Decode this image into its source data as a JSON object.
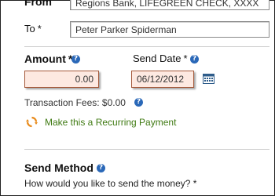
{
  "from": {
    "label": "From",
    "value": "Regions Bank, LIFEGREEN CHECK, XXXX"
  },
  "to": {
    "label": "To",
    "required_mark": "*",
    "value": "Peter Parker Spiderman"
  },
  "amount": {
    "label": "Amount",
    "required_mark": "*",
    "value": "0.00"
  },
  "send_date": {
    "label": "Send Date",
    "required_mark": "*",
    "value": "06/12/2012"
  },
  "fees": {
    "text": "Transaction Fees: $0.00"
  },
  "recurring": {
    "label": "Make this a Recurring Payment"
  },
  "send_method": {
    "heading": "Send Method",
    "question": "How would you like to send the money? *"
  },
  "icons": {
    "help": "help-icon",
    "calendar": "calendar-icon",
    "recurring": "refresh-icon"
  },
  "colors": {
    "help_blue": "#2a68b8",
    "alert_field_bg": "#fde9e1",
    "alert_field_border": "#a5593a",
    "link_green": "#3f7a12",
    "recurring_orange": "#e88a1a"
  }
}
